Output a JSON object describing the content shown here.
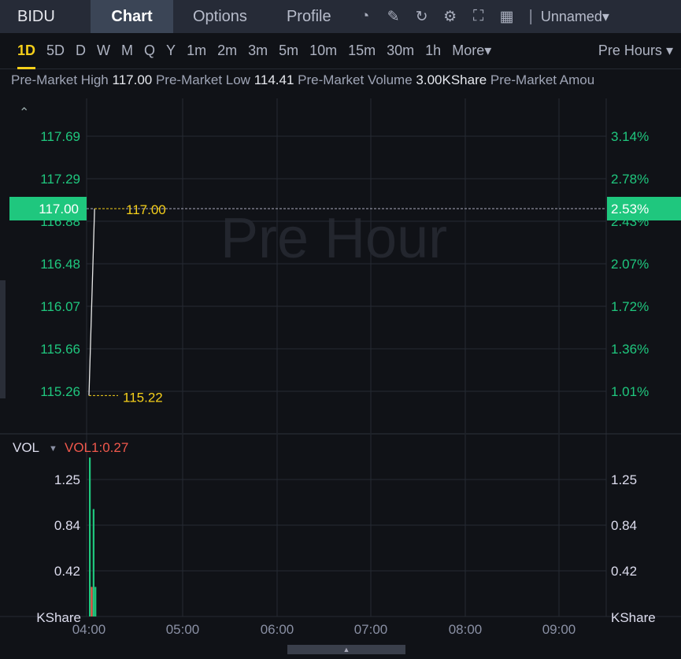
{
  "header": {
    "symbol": "BIDU",
    "tabs": [
      "Chart",
      "Options",
      "Profile"
    ],
    "layout_name": "Unnamed"
  },
  "periods": {
    "items": [
      "1D",
      "5D",
      "D",
      "W",
      "M",
      "Q",
      "Y",
      "1m",
      "2m",
      "3m",
      "5m",
      "10m",
      "15m",
      "30m",
      "1h"
    ],
    "more": "More",
    "session": "Pre Hours"
  },
  "info": {
    "high_label": "Pre-Market High",
    "high": "117.00",
    "low_label": "Pre-Market Low",
    "low": "114.41",
    "volume_label": "Pre-Market Volume",
    "volume": "3.00KShare",
    "amount_label": "Pre-Market Amou"
  },
  "watermark": "Pre Hour",
  "price_pane": {
    "left_ticks": [
      "117.69",
      "117.29",
      "116.88",
      "116.48",
      "116.07",
      "115.66",
      "115.26"
    ],
    "right_ticks": [
      "3.14%",
      "2.78%",
      "2.43%",
      "2.07%",
      "1.72%",
      "1.36%",
      "1.01%"
    ],
    "last_price": "117.00",
    "last_pct": "2.53%",
    "high_marker": "117.00",
    "low_marker": "115.22"
  },
  "volume_pane": {
    "label": "VOL",
    "indicator": "VOL1:0.27",
    "ticks": [
      "1.25",
      "0.84",
      "0.42"
    ],
    "unit": "KShare"
  },
  "x_ticks": [
    "04:00",
    "05:00",
    "06:00",
    "07:00",
    "08:00",
    "09:00"
  ],
  "chart_data": {
    "type": "line",
    "price_range": [
      115.22,
      117.69
    ],
    "price_points": [
      [
        0,
        115.22
      ],
      [
        0.06,
        117.0
      ]
    ],
    "volume": [
      {
        "t": 0,
        "v": 1.45,
        "color": "green"
      },
      {
        "t": 0.02,
        "v": 0.27,
        "color": "red"
      },
      {
        "t": 0.04,
        "v": 0.98,
        "color": "green"
      },
      {
        "t": 0.06,
        "v": 0.27,
        "color": "green"
      }
    ]
  },
  "colors": {
    "up": "#1fc77e",
    "down": "#f0584c",
    "accent": "#f5cf1a"
  }
}
